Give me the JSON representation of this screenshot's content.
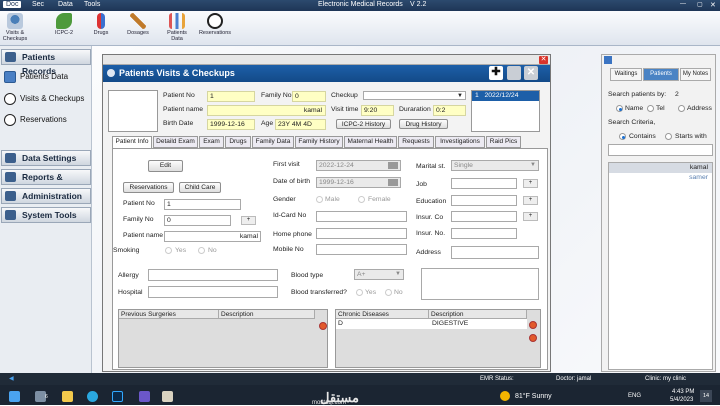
{
  "window": {
    "title": "Electronic Medical Records",
    "version": "V 2.2"
  },
  "menus": [
    "Doc",
    "Sec",
    "Data",
    "Tools"
  ],
  "ribbon": [
    {
      "label": "Visits &\nCheckups",
      "icon": "stethoscope-icon"
    },
    {
      "label": "ICPC-2",
      "icon": "leaf-icon"
    },
    {
      "label": "Drugs",
      "icon": "pill-icon"
    },
    {
      "label": "Dosages",
      "icon": "syringe-icon"
    },
    {
      "label": "Patients\nData",
      "icon": "chart-icon"
    },
    {
      "label": "Reservations",
      "icon": "clock-icon"
    }
  ],
  "sidebar": {
    "sections": [
      "Patients Records",
      "Data Settings",
      "Reports & Charts",
      "Administration",
      "System Tools"
    ],
    "items": [
      "Patients Data",
      "Visits & Checkups",
      "Reservations"
    ]
  },
  "dialog": {
    "title": "Patients Visits & Checkups",
    "patient_no_label": "Patient No",
    "patient_no": "1",
    "family_no_label": "Family No",
    "family_no": "0",
    "patient_name_label": "Patient name",
    "patient_name": "kamal",
    "birth_date_label": "Birth Date",
    "birth_date": "1999-12-16",
    "age_label": "Age",
    "age": "23Y 4M 4D",
    "checkup_label": "Checkup",
    "checkup_value": "",
    "visit_time_label": "Visit time",
    "visit_time": "9:20",
    "duration_label": "Duraration",
    "duration": "0:2",
    "icpc_history": "ICPC-2 History",
    "drug_history": "Drug History",
    "visits_list": [
      {
        "no": "1",
        "date": "2022/12/24"
      }
    ],
    "tabs": [
      "Patient Info",
      "Detaild Exam",
      "Exam",
      "Drugs",
      "Family Data",
      "Family History",
      "Maternal Health",
      "Requests",
      "Investigations",
      "Raid Pics"
    ],
    "edit_btn": "Edit",
    "reservations_btn": "Reservations",
    "child_care_btn": "Child Care",
    "info": {
      "patient_no_label": "Patient No",
      "patient_no": "1",
      "family_no_label": "Family No",
      "family_no": "0",
      "patient_name_label": "Patient name",
      "patient_name": "kamal",
      "smoking_label": "Smoking",
      "yes": "Yes",
      "no": "No",
      "first_visit_label": "First visit",
      "first_visit": "2022-12-24",
      "dob_label": "Date of birth",
      "dob": "1999-12-16",
      "gender_label": "Gender",
      "male": "Male",
      "female": "Female",
      "id_card_label": "Id-Card No",
      "home_phone_label": "Home phone",
      "mobile_label": "Mobile No",
      "marital_label": "Marital st.",
      "marital": "Single",
      "job_label": "Job",
      "education_label": "Education",
      "insur_co_label": "Insur. Co",
      "insur_no_label": "Insur. No.",
      "address_label": "Address",
      "allergy_label": "Allergy",
      "hospital_label": "Hospital",
      "blood_type_label": "Blood type",
      "blood_type": "A+",
      "transfused_label": "Blood transferred?"
    },
    "surgeries": {
      "headers": [
        "Previous Surgeries",
        "Description"
      ]
    },
    "chronic": {
      "headers": [
        "Chronic Diseases",
        "Description"
      ],
      "rows": [
        {
          "disease": "D",
          "description": "DIGESTIVE"
        }
      ]
    }
  },
  "right_panel": {
    "tabs": [
      "Waitings",
      "Patients",
      "My Notes"
    ],
    "search_by_label": "Search patients by:",
    "search_by_count": "2",
    "options": [
      "Name",
      "Tel",
      "Address"
    ],
    "criteria_label": "Search Criteria,",
    "criteria": [
      "Contains",
      "Starts with"
    ],
    "results": [
      "kamal",
      "samer"
    ]
  },
  "status": {
    "emr": "EMR Status:",
    "doctor": "Doctor: jamal",
    "clinic": "Clinic: my clinic"
  },
  "taskbar": {
    "weather": "81°F  Sunny",
    "lang": "ENG",
    "time": "4:43 PM",
    "date": "5/4/2023",
    "badge": "14",
    "mail_count": "6"
  },
  "watermark": {
    "arabic": "مستقل",
    "url": "mostaql.com"
  },
  "colors": {
    "header_blue": "#134a88",
    "sidebar_bg": "#e9edf2",
    "accent_yellow": "#ffffc4"
  }
}
